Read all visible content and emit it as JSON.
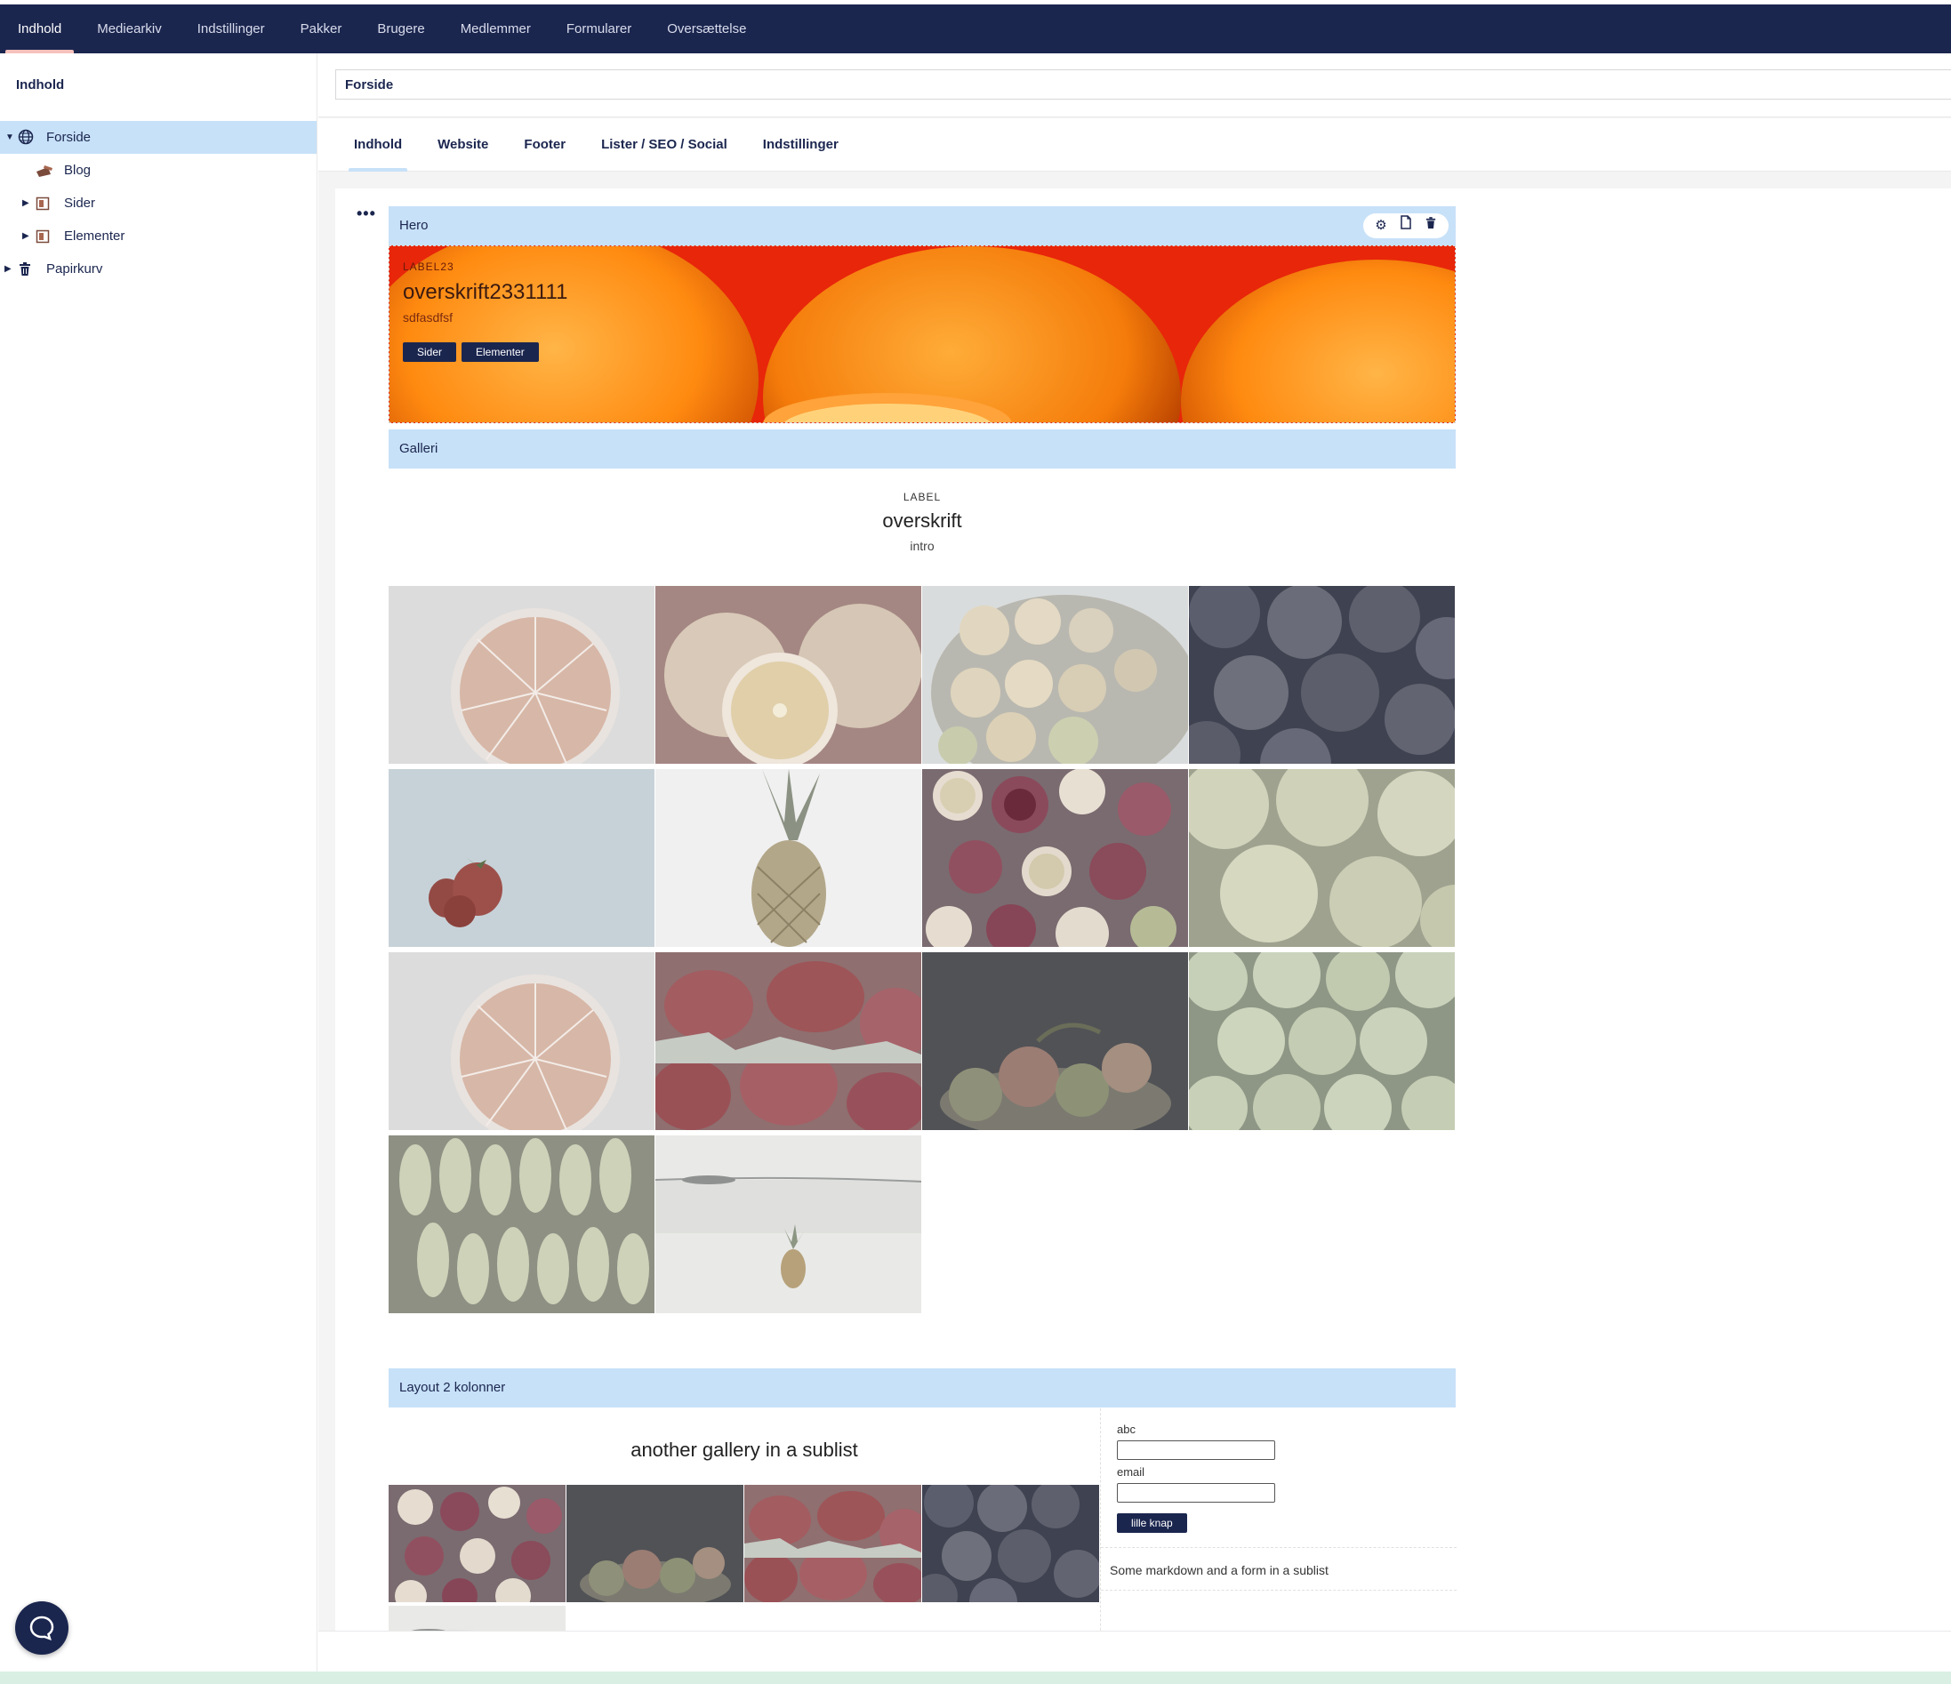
{
  "topnav": {
    "items": [
      {
        "label": "Indhold",
        "active": true
      },
      {
        "label": "Mediearkiv",
        "active": false
      },
      {
        "label": "Indstillinger",
        "active": false
      },
      {
        "label": "Pakker",
        "active": false
      },
      {
        "label": "Brugere",
        "active": false
      },
      {
        "label": "Medlemmer",
        "active": false
      },
      {
        "label": "Formularer",
        "active": false
      },
      {
        "label": "Oversættelse",
        "active": false
      }
    ]
  },
  "sidebar": {
    "title": "Indhold",
    "tree": [
      {
        "label": "Forside",
        "icon": "globe-icon",
        "selected": true
      },
      {
        "label": "Blog",
        "icon": "blog-icon"
      },
      {
        "label": "Sider",
        "icon": "book-icon"
      },
      {
        "label": "Elementer",
        "icon": "book-icon"
      },
      {
        "label": "Papirkurv",
        "icon": "trash-icon"
      }
    ]
  },
  "editor": {
    "node_name": "Forside",
    "tabs": [
      "Indhold",
      "Website",
      "Footer",
      "Lister / SEO / Social",
      "Indstillinger"
    ],
    "actions_icon": "dots-icon"
  },
  "blocks": {
    "hero": {
      "name": "Hero",
      "label": "LABEL23",
      "title": "overskrift2331111",
      "intro": "sdfasdfsf",
      "buttons": [
        "Sider",
        "Elementer"
      ],
      "tools": [
        "gear-icon",
        "copy-icon",
        "trash-icon"
      ]
    },
    "gallery": {
      "name": "Galleri",
      "label": "LABEL",
      "title": "overskrift",
      "intro": "intro",
      "images": [
        "grapefruit-half",
        "oranges-sliced",
        "citrus-basket",
        "plums",
        "strawberries",
        "pineapple",
        "pomegranates",
        "grapefruits",
        "grapefruit-half",
        "strawberries-closeup",
        "fruit-bowl-dark",
        "limes",
        "bananas",
        "pineapple-beach"
      ]
    },
    "layout2": {
      "name": "Layout 2 kolonner",
      "sub_title": "another gallery in a sublist",
      "sub_images": [
        "pomegranates",
        "fruit-bowl-dark",
        "strawberries-closeup",
        "plums",
        "pineapple-beach"
      ],
      "form": {
        "field1_label": "abc",
        "field2_label": "email",
        "button": "lille knap"
      },
      "markdown": "Some markdown and a form in a sublist"
    }
  },
  "chat_icon": "chat-icon",
  "colors": {
    "brand": "#1b264f",
    "accent_blue": "#c7e1f8",
    "accent_pink": "#f5c1bc"
  }
}
